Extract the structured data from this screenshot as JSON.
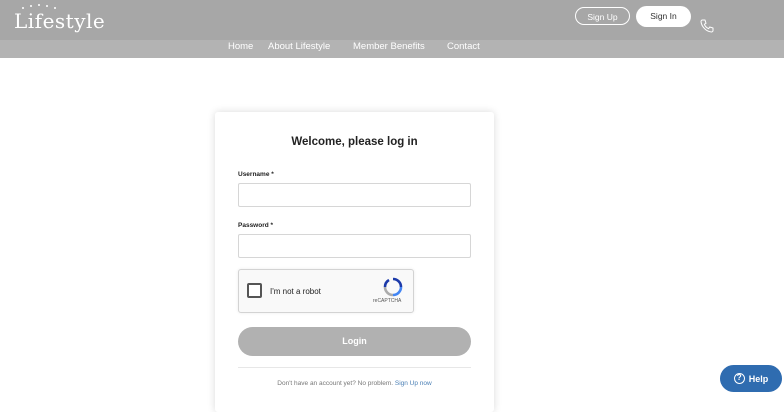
{
  "header": {
    "logo_text": "Lifestyle",
    "signup_label": "Sign Up",
    "signin_label": "Sign In",
    "phone_icon": "phone-icon"
  },
  "nav": {
    "items": [
      "Home",
      "About Lifestyle",
      "Member Benefits",
      "Contact"
    ]
  },
  "login": {
    "title": "Welcome, please log in",
    "username_label": "Username *",
    "username_value": "",
    "password_label": "Password *",
    "password_value": "",
    "captcha_label": "I'm not a robot",
    "captcha_brand": "reCAPTCHA",
    "login_button": "Login",
    "footer_text": "Don't have an account yet? No problem.",
    "footer_link": "Sign Up now"
  },
  "help": {
    "label": "Help"
  },
  "colors": {
    "header_bg": "#a7a7a7",
    "login_button_bg": "#b1b1b1",
    "help_button_bg": "#2f6cb0",
    "link_color": "#4a7fb5"
  }
}
